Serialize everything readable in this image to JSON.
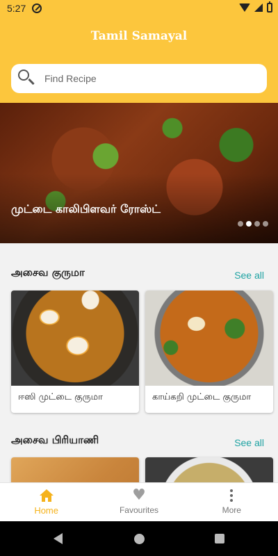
{
  "status_bar": {
    "time": "5:27"
  },
  "app": {
    "title": "Tamil Samayal"
  },
  "search": {
    "placeholder": "Find Recipe"
  },
  "hero": {
    "title": "முட்டை காலிபிளவர் ரோஸ்ட்",
    "slide_count": 4,
    "active_slide": 2
  },
  "sections": [
    {
      "title": "அசைவ குருமா",
      "see_all": "See all",
      "items": [
        {
          "label": "ஈஸி முட்டை குருமா"
        },
        {
          "label": "காய்கறி முட்டை குருமா"
        }
      ]
    },
    {
      "title": "அசைவ பிரியாணி",
      "see_all": "See all",
      "items": [
        {
          "label": ""
        },
        {
          "label": ""
        }
      ]
    }
  ],
  "bottom_nav": {
    "items": [
      {
        "label": "Home",
        "icon": "home-icon",
        "active": true
      },
      {
        "label": "Favourites",
        "icon": "heart-icon",
        "active": false
      },
      {
        "label": "More",
        "icon": "more-vertical-icon",
        "active": false
      }
    ]
  },
  "colors": {
    "header": "#fcc63d",
    "accent_link": "#1fa3a3",
    "nav_active": "#f5b21b"
  }
}
